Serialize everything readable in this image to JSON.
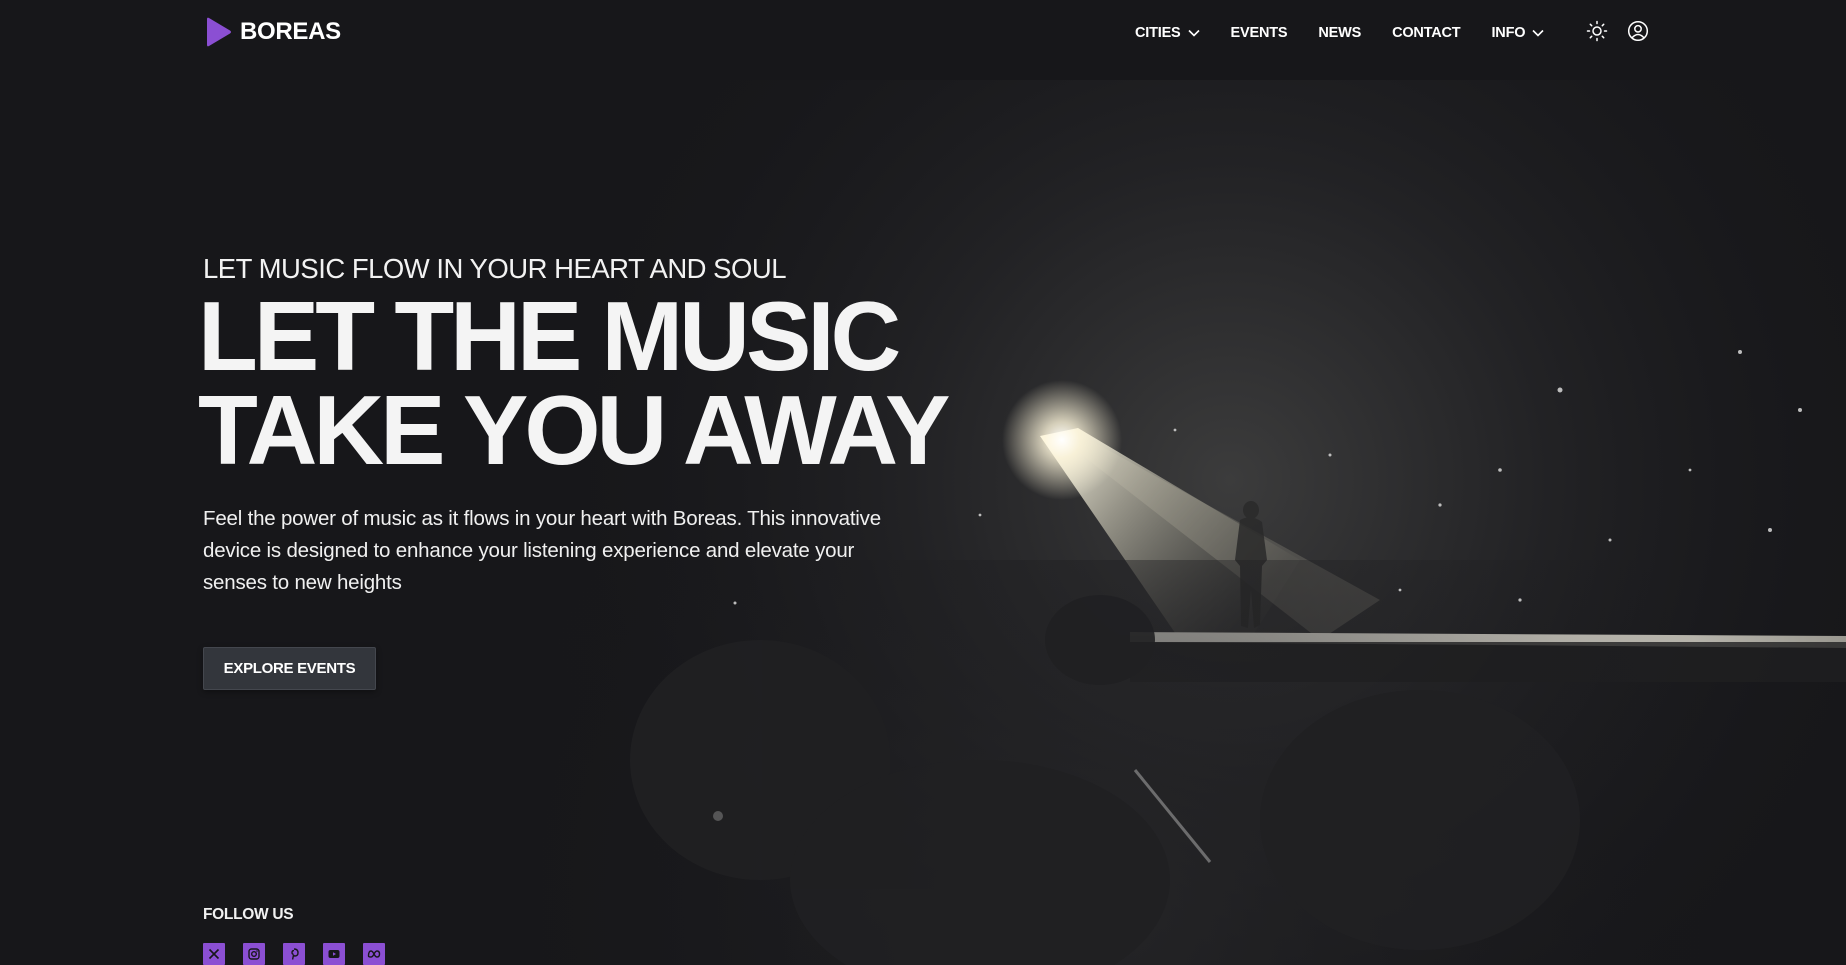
{
  "brand": {
    "name": "BOREAS",
    "accent_color": "#8b4fd3"
  },
  "nav": {
    "items": [
      {
        "label": "CITIES",
        "has_dropdown": true
      },
      {
        "label": "EVENTS",
        "has_dropdown": false
      },
      {
        "label": "NEWS",
        "has_dropdown": false
      },
      {
        "label": "CONTACT",
        "has_dropdown": false
      },
      {
        "label": "INFO",
        "has_dropdown": true
      }
    ],
    "icons": [
      "sun-icon",
      "user-circle-icon"
    ]
  },
  "hero": {
    "eyebrow": "LET MUSIC FLOW IN YOUR HEART AND SOUL",
    "headline_line1": "LET THE MUSIC",
    "headline_line2": "TAKE YOU AWAY",
    "description": "Feel the power of music as it flows in your heart with Boreas. This innovative device is designed to enhance your listening experience and elevate your senses to new heights",
    "cta_label": "EXPLORE EVENTS"
  },
  "follow": {
    "title": "FOLLOW US",
    "icons": [
      "x-icon",
      "instagram-icon",
      "pinterest-icon",
      "youtube-icon",
      "meta-icon"
    ]
  },
  "colors": {
    "background": "#17171a",
    "button_bg": "#33363c",
    "text": "#f2f2f2"
  }
}
